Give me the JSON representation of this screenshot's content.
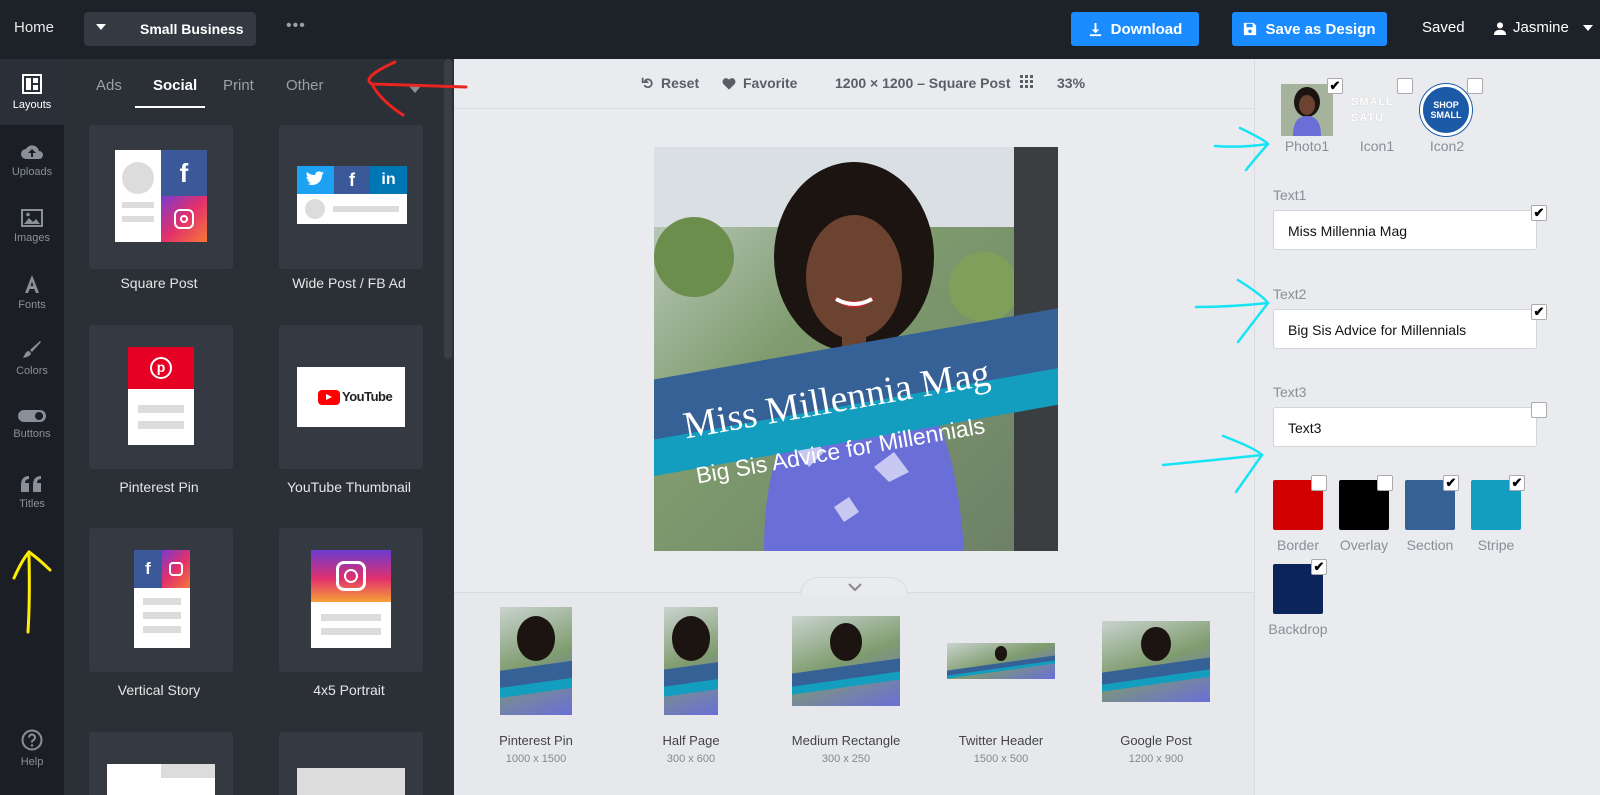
{
  "topbar": {
    "home": "Home",
    "project": "Small Business",
    "more": "•••",
    "download": "Download",
    "save_as_design": "Save as Design",
    "saved": "Saved",
    "user": "Jasmine"
  },
  "rail": [
    {
      "label": "Layouts",
      "icon": "layouts-icon"
    },
    {
      "label": "Uploads",
      "icon": "upload-cloud-icon"
    },
    {
      "label": "Images",
      "icon": "image-icon"
    },
    {
      "label": "Fonts",
      "icon": "font-icon"
    },
    {
      "label": "Colors",
      "icon": "brush-icon"
    },
    {
      "label": "Buttons",
      "icon": "toggle-icon"
    },
    {
      "label": "Titles",
      "icon": "quote-icon"
    },
    {
      "label": "Help",
      "icon": "help-icon"
    }
  ],
  "tabs": [
    "Ads",
    "Social",
    "Print",
    "Other"
  ],
  "layouts": [
    "Square Post",
    "Wide Post / FB Ad",
    "Pinterest Pin",
    "YouTube Thumbnail",
    "Vertical Story",
    "4x5 Portrait"
  ],
  "toolbar": {
    "reset": "Reset",
    "favorite": "Favorite",
    "size": "1200 × 1200 – Square Post",
    "zoom": "33%"
  },
  "design": {
    "text1": "Miss Millennia Mag",
    "text2": "Big Sis Advice for Millennials"
  },
  "thumbnails": [
    {
      "name": "Pinterest Pin",
      "size": "1000 x 1500"
    },
    {
      "name": "Half Page",
      "size": "300 x 600"
    },
    {
      "name": "Medium Rectangle",
      "size": "300 x 250"
    },
    {
      "name": "Twitter Header",
      "size": "1500 x 500"
    },
    {
      "name": "Google Post",
      "size": "1200 x 900"
    }
  ],
  "assets": [
    {
      "label": "Photo1",
      "checked": true
    },
    {
      "label": "Icon1",
      "checked": false
    },
    {
      "label": "Icon2",
      "checked": false
    }
  ],
  "icon1_text": "SMALL SATU",
  "icon2_text": "SHOP SMALL",
  "text_fields": [
    {
      "label": "Text1",
      "value": "Miss Millennia Mag",
      "checked": true
    },
    {
      "label": "Text2",
      "value": "Big Sis Advice for Millennials",
      "checked": true
    },
    {
      "label": "Text3",
      "value": "Text3",
      "checked": false
    }
  ],
  "colors": [
    {
      "label": "Border",
      "hex": "#d20000",
      "checked": false
    },
    {
      "label": "Overlay",
      "hex": "#000000",
      "checked": false
    },
    {
      "label": "Section",
      "hex": "#356196",
      "checked": true
    },
    {
      "label": "Stripe",
      "hex": "#139dbe",
      "checked": true
    },
    {
      "label": "Backdrop",
      "hex": "#0b2459",
      "checked": true
    }
  ],
  "check_mark": "✔"
}
